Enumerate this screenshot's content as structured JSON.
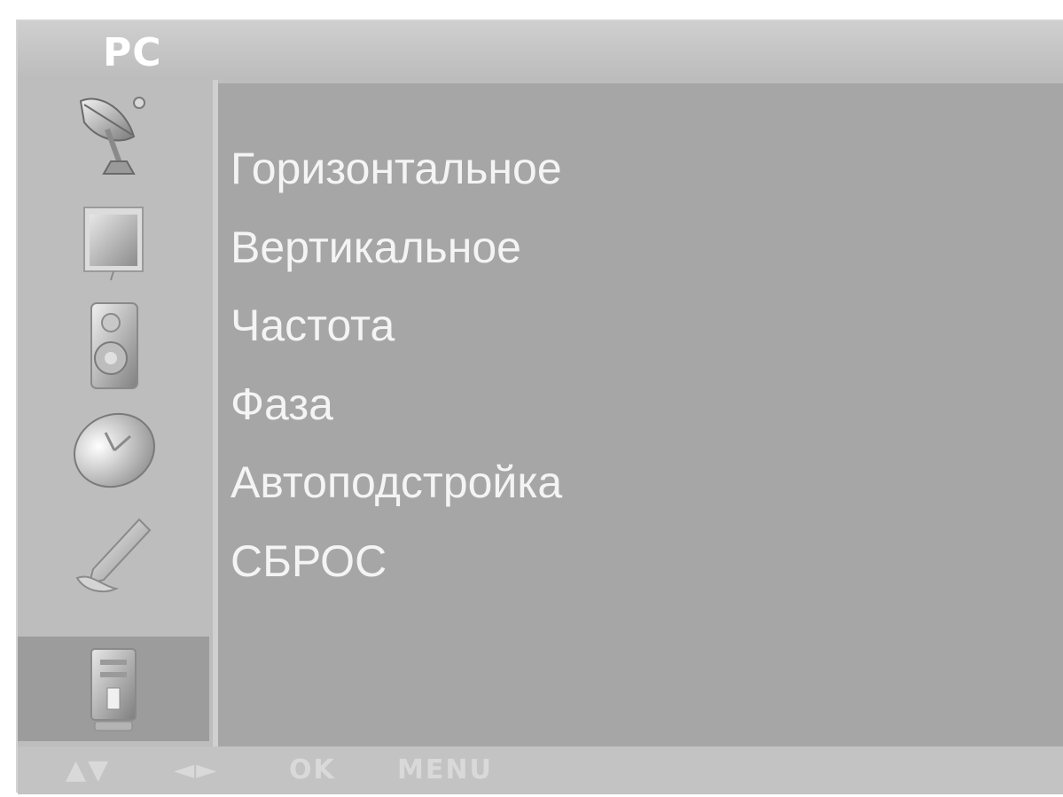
{
  "header": {
    "title": "PC"
  },
  "sidebar": {
    "items": [
      {
        "icon": "satellite-dish-icon",
        "active": false
      },
      {
        "icon": "picture-icon",
        "active": false
      },
      {
        "icon": "speaker-icon",
        "active": false
      },
      {
        "icon": "clock-icon",
        "active": false
      },
      {
        "icon": "tools-icon",
        "active": false
      },
      {
        "icon": "pc-tower-icon",
        "active": true
      }
    ]
  },
  "menu": {
    "items": [
      {
        "label": "Горизонтальное"
      },
      {
        "label": "Вертикальное"
      },
      {
        "label": "Частота"
      },
      {
        "label": "Фаза"
      },
      {
        "label": "Автоподстройка"
      },
      {
        "label": "СБРОС"
      }
    ]
  },
  "help": {
    "updown": "▲▼",
    "leftright": "◄►",
    "ok": "OK",
    "menu": "MENU"
  },
  "colors": {
    "panel": "#bdbdbd",
    "content": "#a6a6a6",
    "active_tab": "#9c9c9c",
    "text": "#f4f4f4"
  }
}
